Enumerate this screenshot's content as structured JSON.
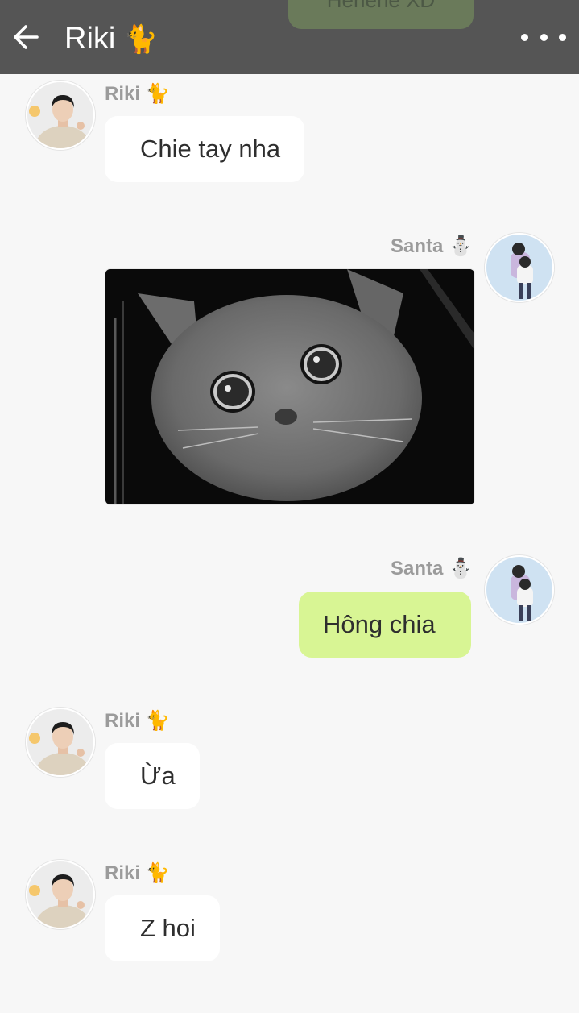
{
  "header": {
    "title": "Riki",
    "title_emoji": "🐈",
    "peek_bubble_text": "Hehehe XD"
  },
  "messages": [
    {
      "sender": "Riki",
      "sender_emoji": "🐈",
      "direction": "in",
      "type": "text",
      "text": "Chie tay nha"
    },
    {
      "sender": "Santa",
      "sender_emoji": "⛄",
      "direction": "out",
      "type": "image",
      "image_desc": "crying-cat-sticker"
    },
    {
      "sender": "Santa",
      "sender_emoji": "⛄",
      "direction": "out",
      "type": "text",
      "text": "Hông chia"
    },
    {
      "sender": "Riki",
      "sender_emoji": "🐈",
      "direction": "in",
      "type": "text",
      "text": "Ừa"
    },
    {
      "sender": "Riki",
      "sender_emoji": "🐈",
      "direction": "in",
      "type": "text",
      "text": "Z hoi"
    }
  ],
  "colors": {
    "header_bg": "#555555",
    "page_bg": "#f7f7f7",
    "incoming_bubble": "#ffffff",
    "outgoing_bubble": "#d8f594",
    "sender_name": "#9b9b9b"
  },
  "icons": {
    "back": "arrow-left-icon",
    "more": "more-dots-icon"
  }
}
